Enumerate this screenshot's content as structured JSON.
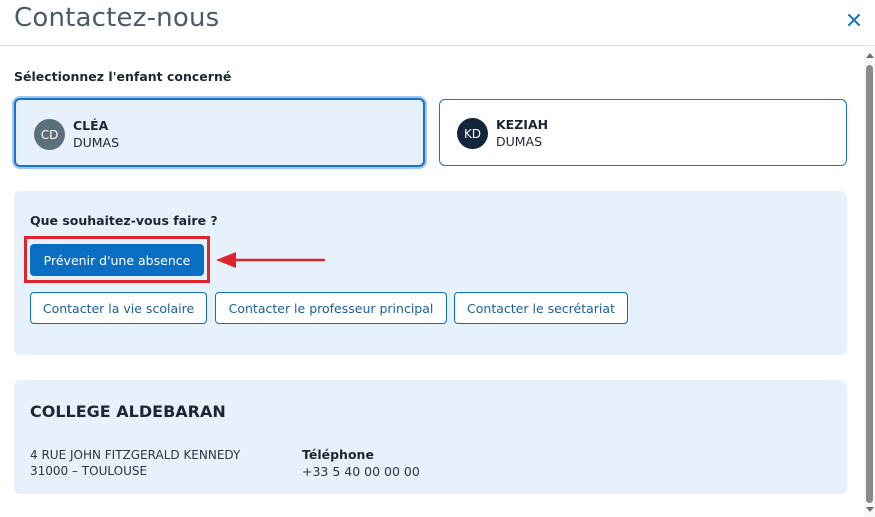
{
  "dialog": {
    "title": "Contactez-nous",
    "close_icon": "close-icon"
  },
  "children_section": {
    "label": "Sélectionnez l'enfant concerné",
    "children": [
      {
        "initials": "CD",
        "first_name": "CLÉA",
        "last_name": "DUMAS",
        "selected": true,
        "avatar_color": "#5b6f7c"
      },
      {
        "initials": "KD",
        "first_name": "KEZIAH",
        "last_name": "DUMAS",
        "selected": false,
        "avatar_color": "#14243a"
      }
    ]
  },
  "actions": {
    "question": "Que souhaitez-vous faire ?",
    "primary": "Prévenir d'une absence",
    "secondary": [
      "Contacter la vie scolaire",
      "Contacter le professeur principal",
      "Contacter le secrétariat"
    ]
  },
  "school": {
    "name": "COLLEGE ALDEBARAN",
    "address_line1": "4 RUE JOHN FITZGERALD KENNEDY",
    "address_line2": "31000 – TOULOUSE",
    "phone_label": "Téléphone",
    "phone_value": "+33 5 40 00 00 00"
  },
  "colors": {
    "accent": "#0a6fc2",
    "panel_bg": "#e6f1fb",
    "highlight": "#e0242c"
  }
}
